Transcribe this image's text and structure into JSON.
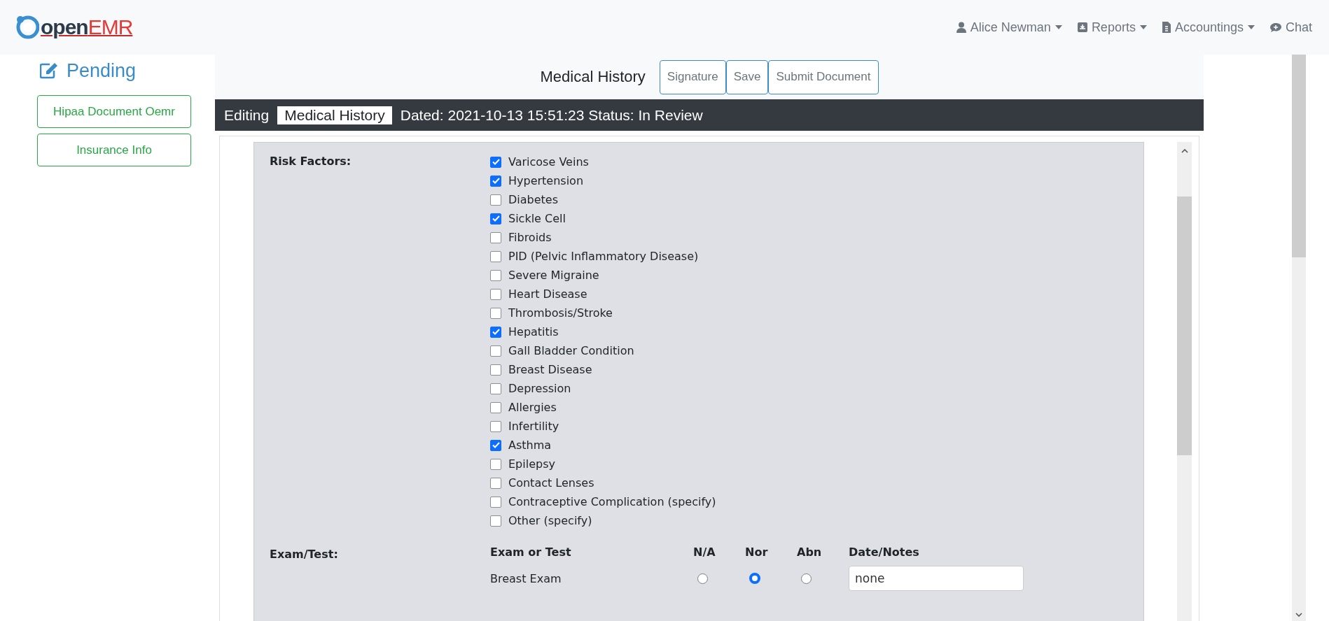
{
  "brand": {
    "logo": "**open**EMR"
  },
  "nav": [
    {
      "label": "Alice Newman",
      "has_menu": true
    },
    {
      "label": "Reports",
      "has_menu": true
    },
    {
      "label": "Accountings",
      "has_menu": true
    },
    {
      "label": "Chat",
      "has_menu": false
    }
  ],
  "sidebar": {
    "heading": "Pending",
    "items": [
      "Hipaa Document Oemr",
      "Insurance Info"
    ]
  },
  "document": {
    "title": "Medical History",
    "buttons": [
      "Signature",
      "Save",
      "Submit Document"
    ]
  },
  "status_bar": {
    "prefix": "Editing",
    "name": "Medical History",
    "info": "Dated: 2021-10-13 15:51:23 Status: In Review"
  },
  "risk_factors": {
    "label": "Risk Factors:",
    "items": [
      {
        "label": "Varicose Veins",
        "checked": true
      },
      {
        "label": "Hypertension",
        "checked": true
      },
      {
        "label": "Diabetes",
        "checked": false
      },
      {
        "label": "Sickle Cell",
        "checked": true
      },
      {
        "label": "Fibroids",
        "checked": false
      },
      {
        "label": "PID (Pelvic Inflammatory Disease)",
        "checked": false
      },
      {
        "label": "Severe Migraine",
        "checked": false
      },
      {
        "label": "Heart Disease",
        "checked": false
      },
      {
        "label": "Thrombosis/Stroke",
        "checked": false
      },
      {
        "label": "Hepatitis",
        "checked": true
      },
      {
        "label": "Gall Bladder Condition",
        "checked": false
      },
      {
        "label": "Breast Disease",
        "checked": false
      },
      {
        "label": "Depression",
        "checked": false
      },
      {
        "label": "Allergies",
        "checked": false
      },
      {
        "label": "Infertility",
        "checked": false
      },
      {
        "label": "Asthma",
        "checked": true
      },
      {
        "label": "Epilepsy",
        "checked": false
      },
      {
        "label": "Contact Lenses",
        "checked": false
      },
      {
        "label": "Contraceptive Complication (specify)",
        "checked": false
      },
      {
        "label": "Other (specify)",
        "checked": false
      }
    ]
  },
  "exam": {
    "label": "Exam/Test:",
    "columns": [
      "Exam or Test",
      "N/A",
      "Nor",
      "Abn",
      "Date/Notes"
    ],
    "rows": [
      {
        "name": "Breast Exam",
        "options": [
          {
            "selected": false
          },
          {
            "selected": true
          },
          {
            "selected": false
          }
        ],
        "notes": "none"
      }
    ]
  }
}
